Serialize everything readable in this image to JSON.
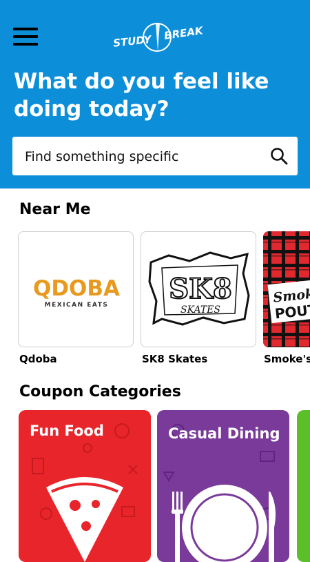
{
  "header": {
    "logo_text": "STUDY BREAK",
    "headline": "What do you feel like doing today?",
    "menu_icon": "hamburger-menu-icon"
  },
  "search": {
    "placeholder": "Find something specific",
    "icon": "search-icon"
  },
  "near_me": {
    "title": "Near Me",
    "items": [
      {
        "name": "Qdoba",
        "logo_main": "QDOBA",
        "logo_sub": "MEXICAN EATS"
      },
      {
        "name": "SK8 Skates",
        "logo_main": "SK8",
        "logo_sub": "SKATES"
      },
      {
        "name": "Smoke's",
        "logo_main": "Smoke",
        "logo_sub": "POUT"
      }
    ]
  },
  "coupon_categories": {
    "title": "Coupon Categories",
    "items": [
      {
        "label": "Fun Food",
        "color": "#e8252b"
      },
      {
        "label": "Casual Dining",
        "color": "#7a3a9a"
      },
      {
        "label": "",
        "color": "#5cbf2a"
      }
    ]
  },
  "colors": {
    "header_bg": "#0d8ed9",
    "qdoba_orange": "#e89a1f",
    "smokes_red": "#e0282e"
  }
}
